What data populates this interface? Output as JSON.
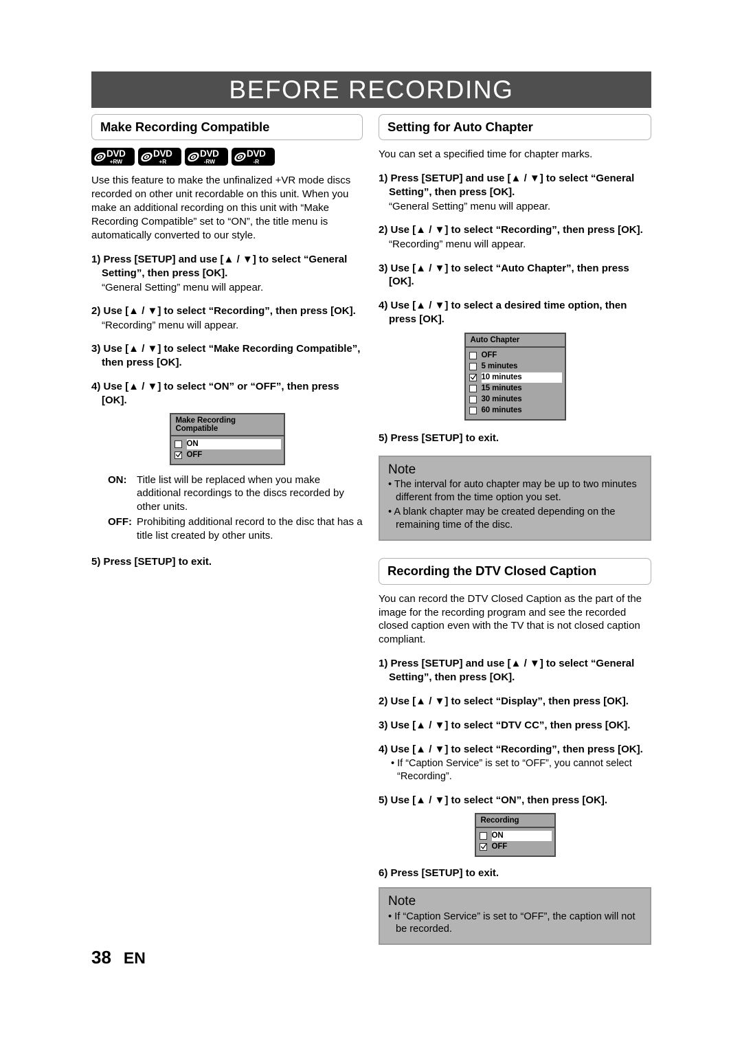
{
  "chapter": {
    "title": "BEFORE RECORDING"
  },
  "footer": {
    "page_number": "38",
    "language": "EN"
  },
  "left_column": {
    "section_title": "Make Recording Compatible",
    "disc_logos": [
      {
        "main": "DVD",
        "sub": "+RW",
        "name": "dvd-plus-rw-logo"
      },
      {
        "main": "DVD",
        "sub": "+R",
        "name": "dvd-plus-r-logo"
      },
      {
        "main": "DVD",
        "sub": "-RW",
        "name": "dvd-minus-rw-logo"
      },
      {
        "main": "DVD",
        "sub": "-R",
        "name": "dvd-minus-r-logo"
      }
    ],
    "intro": "Use this feature to make the unfinalized +VR mode discs recorded on other unit recordable on this unit. When you make an additional recording on this unit with “Make Recording Compatible” set to “ON”, the title menu is automatically converted to our style.",
    "steps": [
      {
        "text": "1) Press [SETUP] and use [▲ / ▼] to select “General Setting”, then press [OK].",
        "note": "“General Setting” menu will appear."
      },
      {
        "text": "2) Use [▲ / ▼] to select “Recording”, then press [OK].",
        "note": "“Recording” menu will appear."
      },
      {
        "text": "3) Use [▲ / ▼] to select “Make Recording Compatible”, then press [OK].",
        "note": ""
      },
      {
        "text": "4) Use [▲ / ▼] to select “ON” or “OFF”, then press [OK].",
        "note": ""
      }
    ],
    "menu": {
      "title": "Make Recording Compatible",
      "options": [
        {
          "label": "ON",
          "checked": false,
          "selected": true
        },
        {
          "label": "OFF",
          "checked": true,
          "selected": false
        }
      ]
    },
    "definitions": [
      {
        "term": "ON:",
        "description": "Title list will be replaced when you make additional recordings to the discs recorded by other units."
      },
      {
        "term": "OFF:",
        "description": "Prohibiting additional record to the disc that has a title list created by other units."
      }
    ],
    "exit_step": "5) Press [SETUP] to exit."
  },
  "right_column": {
    "auto_chapter": {
      "section_title": "Setting for Auto Chapter",
      "intro": "You can set a specified time for chapter marks.",
      "steps": [
        {
          "text": "1) Press [SETUP] and use [▲ / ▼] to select “General Setting”, then press [OK].",
          "note": "“General Setting” menu will appear."
        },
        {
          "text": "2) Use [▲ / ▼] to select “Recording”, then press [OK].",
          "note": "“Recording” menu will appear."
        },
        {
          "text": "3) Use [▲ / ▼] to select “Auto Chapter”, then press [OK].",
          "note": ""
        },
        {
          "text": "4) Use [▲ / ▼] to select a desired time option, then press [OK].",
          "note": ""
        }
      ],
      "menu": {
        "title": "Auto Chapter",
        "options": [
          {
            "label": "OFF",
            "checked": false,
            "selected": false
          },
          {
            "label": "5 minutes",
            "checked": false,
            "selected": false
          },
          {
            "label": "10 minutes",
            "checked": true,
            "selected": true
          },
          {
            "label": "15 minutes",
            "checked": false,
            "selected": false
          },
          {
            "label": "30 minutes",
            "checked": false,
            "selected": false
          },
          {
            "label": "60 minutes",
            "checked": false,
            "selected": false
          }
        ]
      },
      "exit_step": "5) Press [SETUP] to exit.",
      "note": {
        "heading": "Note",
        "items": [
          "• The interval for auto chapter may be up to two minutes different from the time option you set.",
          "• A blank chapter may be created depending on the remaining time of the disc."
        ]
      }
    },
    "dtv_caption": {
      "section_title": "Recording the DTV Closed Caption",
      "intro": "You can record the DTV Closed Caption as the part of the image for the recording program and see the recorded closed caption even with the TV that is not closed caption compliant.",
      "steps": [
        {
          "text": "1) Press [SETUP] and use [▲ / ▼] to select “General Setting”, then press [OK].",
          "note": ""
        },
        {
          "text": "2) Use [▲ / ▼] to select “Display”, then press [OK].",
          "note": ""
        },
        {
          "text": "3) Use [▲ / ▼] to select “DTV CC”, then press [OK].",
          "note": ""
        },
        {
          "text": "4) Use [▲ / ▼] to select “Recording”, then press [OK].",
          "note": "",
          "bullet": "• If “Caption Service” is set to “OFF”, you cannot select “Recording”."
        },
        {
          "text": "5) Use [▲ / ▼] to select “ON”, then press [OK].",
          "note": ""
        }
      ],
      "menu": {
        "title": "Recording",
        "options": [
          {
            "label": "ON",
            "checked": false,
            "selected": true
          },
          {
            "label": "OFF",
            "checked": true,
            "selected": false
          }
        ]
      },
      "exit_step": "6) Press [SETUP] to exit.",
      "note": {
        "heading": "Note",
        "items": [
          "• If “Caption Service” is set to “OFF”, the caption will not be recorded."
        ]
      }
    }
  },
  "colors": {
    "chapter_bar": "#4f4f4f",
    "menu_background": "#a6a6a6",
    "menu_border": "#4a4a4a",
    "note_background": "#b4b4b4",
    "note_border": "#9a9a9a"
  }
}
